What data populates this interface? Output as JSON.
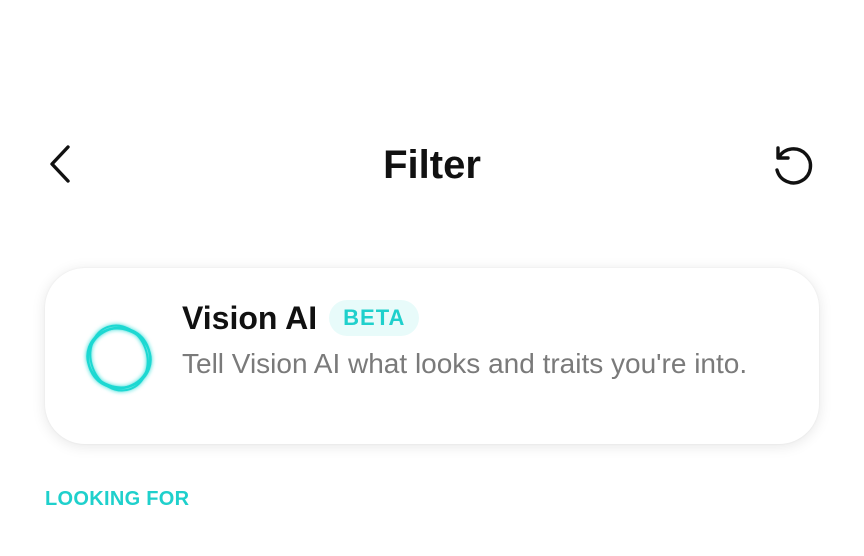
{
  "header": {
    "back_icon": "chevron-left-icon",
    "title": "Filter",
    "reset_icon": "reset-icon"
  },
  "vision_ai_card": {
    "icon": "vision-orb-icon",
    "title": "Vision AI",
    "badge": "BETA",
    "description": "Tell Vision AI what looks and traits you're into."
  },
  "sections": {
    "looking_for_label": "LOOKING FOR"
  },
  "colors": {
    "accent": "#1fd0cc",
    "badge_bg": "#e8fbfa",
    "text_primary": "#111111",
    "text_secondary": "#7a7a7a"
  }
}
